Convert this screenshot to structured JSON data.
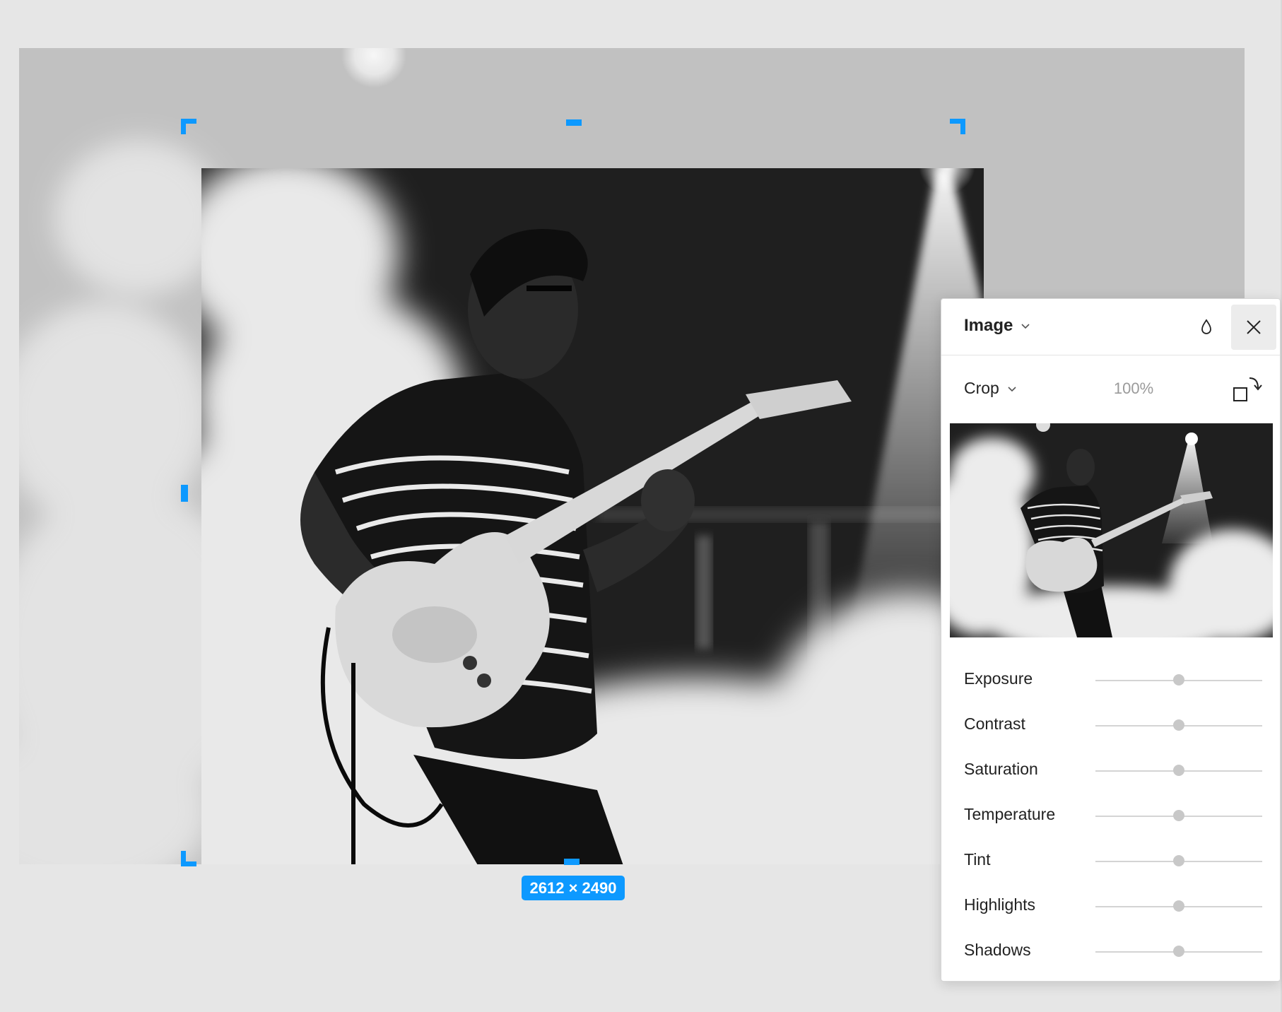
{
  "canvas": {
    "dimensions_label": "2612 × 2490",
    "accent_color": "#0d99ff"
  },
  "panel": {
    "title": "Image",
    "icons": {
      "title_dropdown": "chevron-down-icon",
      "opacity": "droplet-icon",
      "close": "close-icon",
      "crop_dropdown": "chevron-down-icon",
      "rotate": "rotate-icon"
    },
    "crop_mode": "Crop",
    "zoom": "100%",
    "adjustments": [
      {
        "label": "Exposure",
        "value": 0
      },
      {
        "label": "Contrast",
        "value": 0
      },
      {
        "label": "Saturation",
        "value": 0
      },
      {
        "label": "Temperature",
        "value": 0
      },
      {
        "label": "Tint",
        "value": 0
      },
      {
        "label": "Highlights",
        "value": 0
      },
      {
        "label": "Shadows",
        "value": 0
      }
    ]
  }
}
